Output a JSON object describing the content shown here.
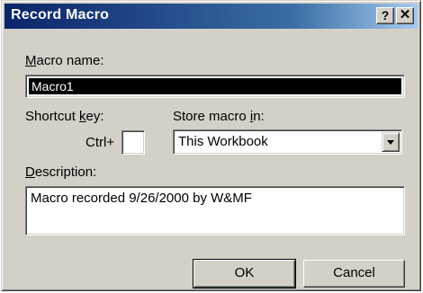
{
  "window": {
    "title": "Record Macro",
    "help_glyph": "?",
    "close_glyph": "✕"
  },
  "macro_name": {
    "label_accel": "M",
    "label_rest": "acro name:",
    "value": "Macro1"
  },
  "shortcut": {
    "label_pre": "Shortcut ",
    "label_accel": "k",
    "label_post": "ey:",
    "ctrl_label": "Ctrl+",
    "value": ""
  },
  "store": {
    "label_pre": "Store macro ",
    "label_accel": "i",
    "label_post": "n:",
    "selected": "This Workbook"
  },
  "description": {
    "label_accel": "D",
    "label_rest": "escription:",
    "value": "Macro recorded 9/26/2000 by W&MF"
  },
  "buttons": {
    "ok": "OK",
    "cancel": "Cancel"
  },
  "colors": {
    "titlebar_start": "#0a246a",
    "titlebar_end": "#a6caf0",
    "face": "#d4d0c8"
  }
}
